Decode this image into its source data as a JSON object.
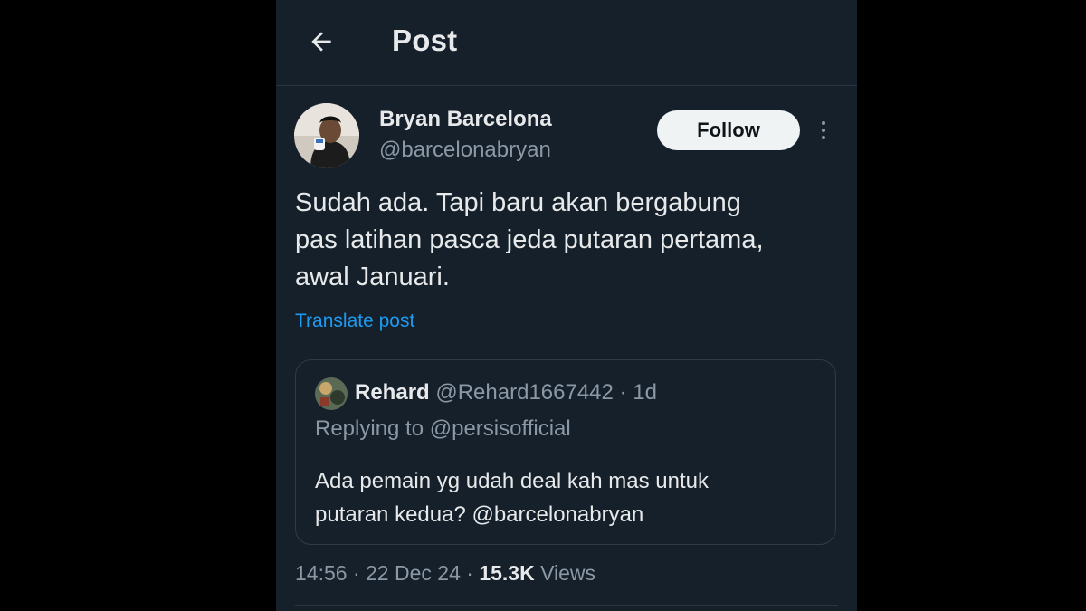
{
  "header": {
    "title": "Post",
    "back_icon": "arrow-left-icon"
  },
  "author": {
    "name": "Bryan Barcelona",
    "handle": "@barcelonabryan",
    "follow_label": "Follow"
  },
  "post": {
    "text_line1": "Sudah ada. Tapi baru akan bergabung",
    "text_line2": "pas latihan pasca jeda putaran pertama,",
    "text_line3": "awal Januari.",
    "translate_label": "Translate post",
    "time": "14:56",
    "date": "22 Dec 24",
    "views_count": "15.3K",
    "views_label": "Views"
  },
  "quoted": {
    "name": "Rehard",
    "handle": "@Rehard1667442",
    "age": "1d",
    "replying_prefix": "Replying to",
    "replying_to": "@persisofficial",
    "text_line1": "Ada pemain yg udah deal kah mas untuk",
    "text_line2": "putaran kedua? @barcelonabryan"
  },
  "colors": {
    "background": "#15202b",
    "text_primary": "#e7e9ea",
    "text_secondary": "#8b98a5",
    "link": "#1d9bf0",
    "follow_bg": "#eff3f4"
  }
}
